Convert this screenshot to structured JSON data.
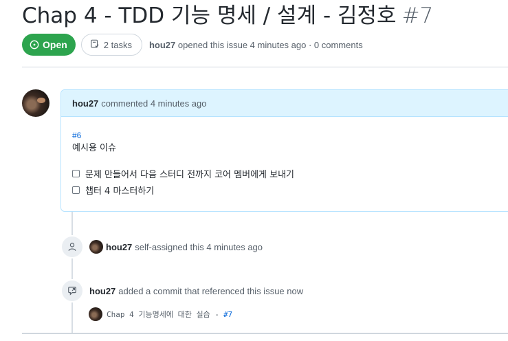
{
  "issue": {
    "title": "Chap 4 - TDD 기능 명세 / 설계 - 김정호",
    "number": "#7",
    "state": "Open",
    "tasks": "2 tasks",
    "author": "hou27",
    "meta": "opened this issue 4 minutes ago · 0 comments"
  },
  "comment": {
    "author": "hou27",
    "action": "commented 4 minutes ago",
    "ref_link": "#6",
    "body": "예시용 이슈",
    "tasks": [
      {
        "label": "문제 만들어서 다음 스터디 전까지 코어 멤버에게 보내기",
        "checked": false
      },
      {
        "label": "챕터 4 마스터하기",
        "checked": false
      }
    ]
  },
  "events": {
    "assigned": {
      "author": "hou27",
      "text": "self-assigned this 4 minutes ago"
    },
    "referenced": {
      "author": "hou27",
      "text": "added a commit that referenced this issue now"
    },
    "commit": {
      "message": "Chap 4 기능명세에 대한 실습 -",
      "link": "#7"
    }
  },
  "colors": {
    "open_badge": "#2da44e",
    "comment_header": "#ddf4ff",
    "comment_border": "#b6e3ff",
    "link": "#0969da"
  },
  "icons": {
    "state": "issue-opened-icon",
    "tasks": "checklist-icon",
    "assigned": "person-icon",
    "referenced": "cross-reference-icon"
  }
}
